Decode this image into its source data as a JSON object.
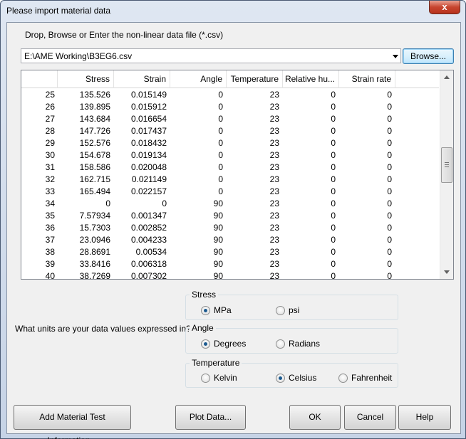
{
  "window": {
    "title": "Please import material data",
    "close_label": "x"
  },
  "file": {
    "prompt": "Drop, Browse or Enter the non-linear data file (*.csv)",
    "path": "E:\\AME Working\\B3EG6.csv",
    "browse_label": "Browse..."
  },
  "table": {
    "columns": [
      "",
      "Stress",
      "Strain",
      "Angle",
      "Temperature",
      "Relative hu...",
      "Strain rate"
    ],
    "rows": [
      [
        "25",
        "135.526",
        "0.015149",
        "0",
        "23",
        "0",
        "0"
      ],
      [
        "26",
        "139.895",
        "0.015912",
        "0",
        "23",
        "0",
        "0"
      ],
      [
        "27",
        "143.684",
        "0.016654",
        "0",
        "23",
        "0",
        "0"
      ],
      [
        "28",
        "147.726",
        "0.017437",
        "0",
        "23",
        "0",
        "0"
      ],
      [
        "29",
        "152.576",
        "0.018432",
        "0",
        "23",
        "0",
        "0"
      ],
      [
        "30",
        "154.678",
        "0.019134",
        "0",
        "23",
        "0",
        "0"
      ],
      [
        "31",
        "158.586",
        "0.020048",
        "0",
        "23",
        "0",
        "0"
      ],
      [
        "32",
        "162.715",
        "0.021149",
        "0",
        "23",
        "0",
        "0"
      ],
      [
        "33",
        "165.494",
        "0.022157",
        "0",
        "23",
        "0",
        "0"
      ],
      [
        "34",
        "0",
        "0",
        "90",
        "23",
        "0",
        "0"
      ],
      [
        "35",
        "7.57934",
        "0.001347",
        "90",
        "23",
        "0",
        "0"
      ],
      [
        "36",
        "15.7303",
        "0.002852",
        "90",
        "23",
        "0",
        "0"
      ],
      [
        "37",
        "23.0946",
        "0.004233",
        "90",
        "23",
        "0",
        "0"
      ],
      [
        "38",
        "28.8691",
        "0.00534",
        "90",
        "23",
        "0",
        "0"
      ],
      [
        "39",
        "33.8416",
        "0.006318",
        "90",
        "23",
        "0",
        "0"
      ],
      [
        "40",
        "38.7269",
        "0.007302",
        "90",
        "23",
        "0",
        "0"
      ]
    ]
  },
  "units": {
    "question": "What units are your data values expressed in?",
    "stress": {
      "title": "Stress",
      "options": [
        "MPa",
        "psi"
      ],
      "selected": "MPa"
    },
    "angle": {
      "title": "Angle",
      "options": [
        "Degrees",
        "Radians"
      ],
      "selected": "Degrees"
    },
    "temperature": {
      "title": "Temperature",
      "options": [
        "Kelvin",
        "Celsius",
        "Fahrenheit"
      ],
      "selected": "Celsius"
    }
  },
  "buttons": {
    "add_info": "Add Material Test Information...",
    "plot": "Plot Data...",
    "ok": "OK",
    "cancel": "Cancel",
    "help": "Help"
  }
}
